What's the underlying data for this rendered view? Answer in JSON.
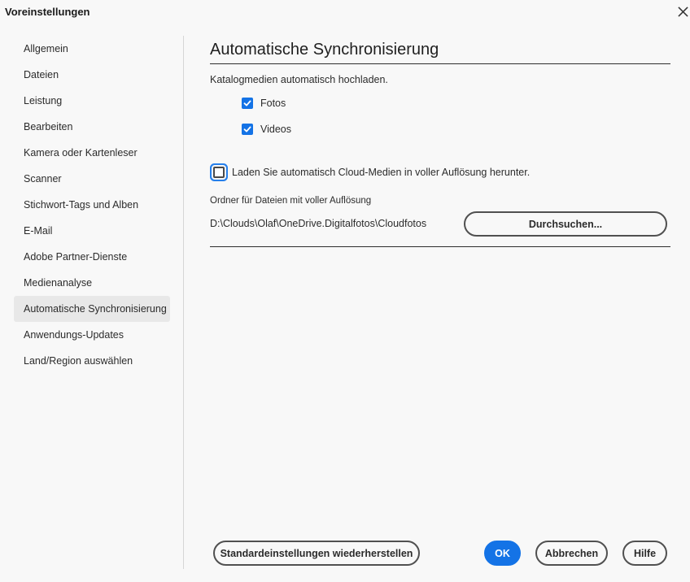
{
  "window": {
    "title": "Voreinstellungen"
  },
  "sidebar": {
    "items": [
      {
        "label": "Allgemein"
      },
      {
        "label": "Dateien"
      },
      {
        "label": "Leistung"
      },
      {
        "label": "Bearbeiten"
      },
      {
        "label": "Kamera oder Kartenleser"
      },
      {
        "label": "Scanner"
      },
      {
        "label": "Stichwort-Tags und Alben"
      },
      {
        "label": "E-Mail"
      },
      {
        "label": "Adobe Partner-Dienste"
      },
      {
        "label": "Medienanalyse"
      },
      {
        "label": "Automatische Synchronisierung",
        "selected": true
      },
      {
        "label": "Anwendungs-Updates"
      },
      {
        "label": "Land/Region auswählen"
      }
    ]
  },
  "main": {
    "title": "Automatische Synchronisierung",
    "intro": "Katalogmedien automatisch hochladen.",
    "checkboxes": {
      "fotos": {
        "label": "Fotos",
        "checked": true
      },
      "videos": {
        "label": "Videos",
        "checked": true
      },
      "cloud_download": {
        "label": "Laden Sie automatisch Cloud-Medien in voller Auflösung herunter.",
        "checked": false
      }
    },
    "folder_label": "Ordner für Dateien mit voller Auflösung",
    "folder_path": "D:\\Clouds\\Olaf\\OneDrive.Digitalfotos\\Cloudfotos",
    "browse_label": "Durchsuchen..."
  },
  "footer": {
    "defaults_label": "Standardeinstellungen wiederherstellen",
    "ok_label": "OK",
    "cancel_label": "Abbrechen",
    "help_label": "Hilfe"
  },
  "colors": {
    "accent": "#1473e6",
    "focus_ring": "#2680eb",
    "background": "#f8f8f8",
    "selected_item": "#e8e8e8"
  },
  "icons": {
    "close": "close-icon",
    "check": "checkmark-icon"
  }
}
